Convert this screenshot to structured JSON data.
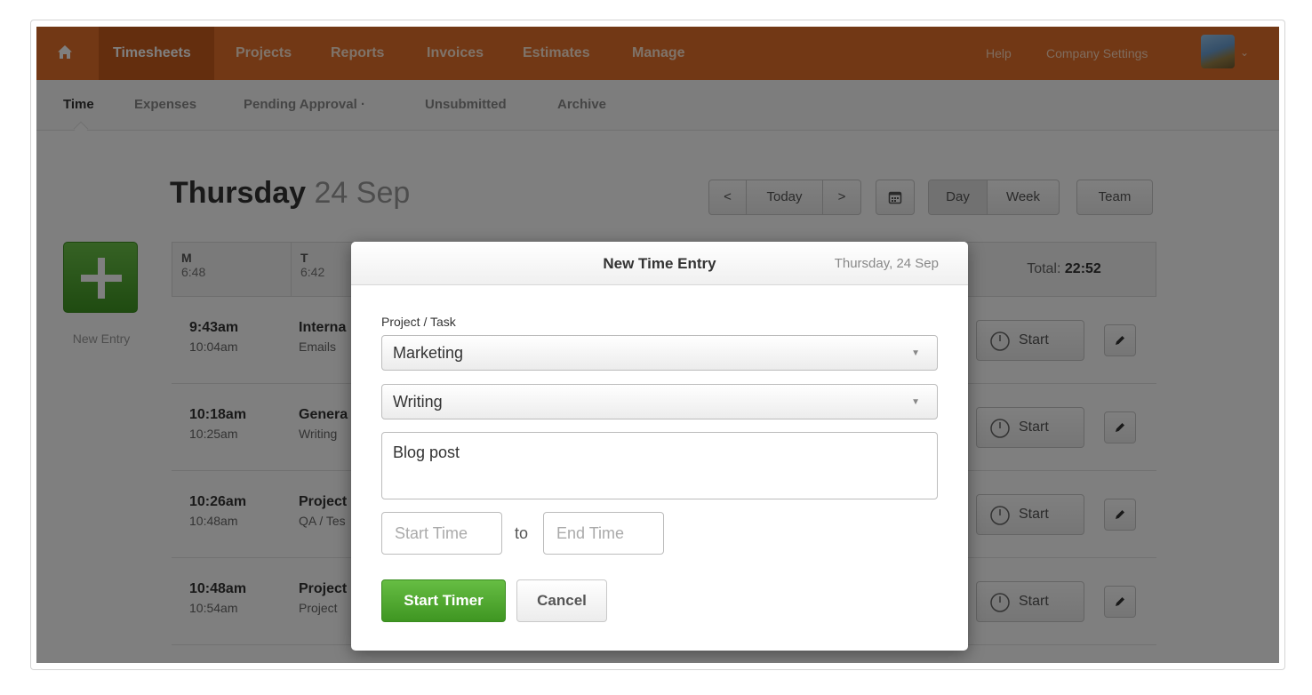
{
  "top_nav": {
    "items": [
      "Timesheets",
      "Projects",
      "Reports",
      "Invoices",
      "Estimates",
      "Manage"
    ],
    "active": "Timesheets",
    "help": "Help",
    "company_settings": "Company Settings"
  },
  "sub_nav": {
    "items": [
      "Time",
      "Expenses",
      "Pending Approval ·",
      "Unsubmitted",
      "Archive"
    ],
    "active": "Time"
  },
  "day_header": {
    "weekday": "Thursday",
    "date": "24 Sep"
  },
  "nav_controls": {
    "prev": "<",
    "today": "Today",
    "next": ">",
    "calendar_icon": "calendar-icon",
    "views": [
      "Day",
      "Week"
    ],
    "active_view": "Day",
    "team": "Team"
  },
  "new_entry": {
    "label": "New Entry"
  },
  "week": [
    {
      "label": "M",
      "hours": "6:48"
    },
    {
      "label": "T",
      "hours": "6:42"
    }
  ],
  "total": {
    "label": "Total:",
    "value": "22:52"
  },
  "entries": [
    {
      "start": "9:43am",
      "end": "10:04am",
      "project": "Interna",
      "task": "Emails"
    },
    {
      "start": "10:18am",
      "end": "10:25am",
      "project": "Genera",
      "task": "Writing"
    },
    {
      "start": "10:26am",
      "end": "10:48am",
      "project": "Project",
      "task": "QA / Tes"
    },
    {
      "start": "10:48am",
      "end": "10:54am",
      "project": "Project",
      "task": "Project"
    }
  ],
  "entry_actions": {
    "start_label": "Start"
  },
  "modal": {
    "title": "New Time Entry",
    "date": "Thursday, 24 Sep",
    "project_task_label": "Project / Task",
    "project_value": "Marketing",
    "task_value": "Writing",
    "notes_value": "Blog post",
    "start_time_placeholder": "Start Time",
    "to_label": "to",
    "end_time_placeholder": "End Time",
    "primary_button": "Start Timer",
    "cancel_button": "Cancel"
  },
  "colors": {
    "brand_orange": "#e4702a",
    "active_nav": "#c95c1c",
    "green": "#4fa82f"
  }
}
